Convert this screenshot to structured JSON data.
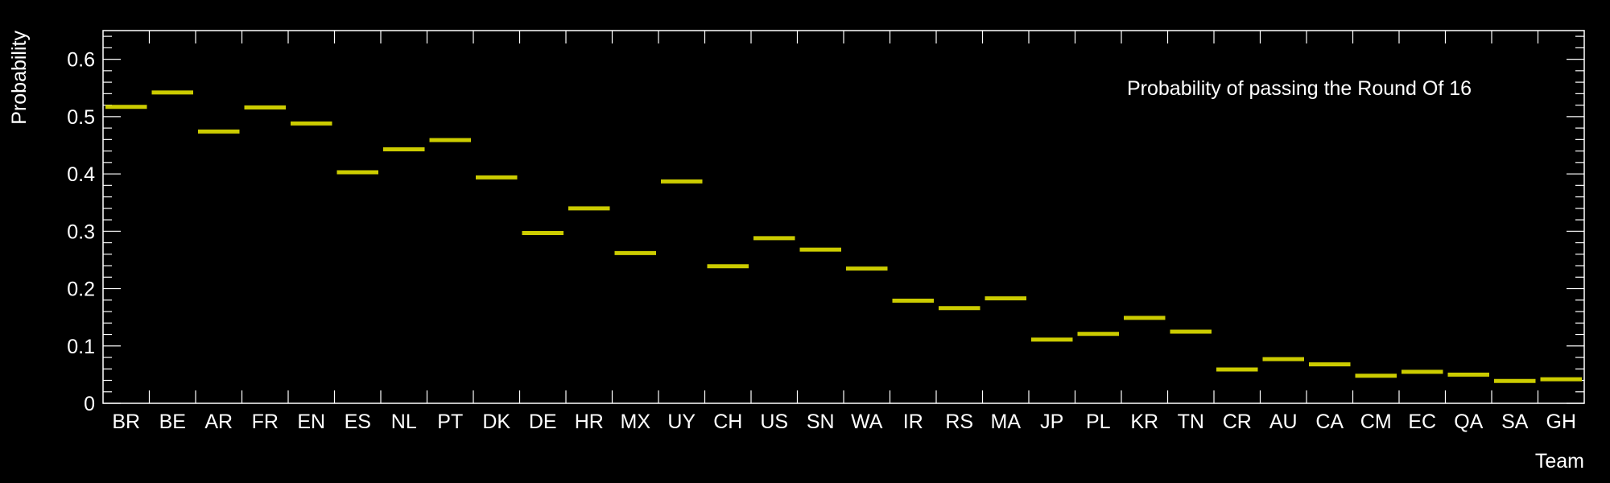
{
  "chart_data": {
    "type": "step",
    "title": "Probability of passing the Round Of 16",
    "xlabel": "Team",
    "ylabel": "Probability",
    "ylim": [
      0,
      0.65
    ],
    "yticks": [
      0,
      0.1,
      0.2,
      0.3,
      0.4,
      0.5,
      0.6
    ],
    "ytick_labels": [
      "0",
      "0.1",
      "0.2",
      "0.3",
      "0.4",
      "0.5",
      "0.6"
    ],
    "grid": false,
    "legend": "none",
    "categories": [
      "BR",
      "BE",
      "AR",
      "FR",
      "EN",
      "ES",
      "NL",
      "PT",
      "DK",
      "DE",
      "HR",
      "MX",
      "UY",
      "CH",
      "US",
      "SN",
      "WA",
      "IR",
      "RS",
      "MA",
      "JP",
      "PL",
      "KR",
      "TN",
      "CR",
      "AU",
      "CA",
      "CM",
      "EC",
      "QA",
      "SA",
      "GH"
    ],
    "values": [
      0.517,
      0.542,
      0.474,
      0.516,
      0.488,
      0.403,
      0.443,
      0.459,
      0.394,
      0.297,
      0.34,
      0.262,
      0.387,
      0.239,
      0.288,
      0.268,
      0.235,
      0.179,
      0.166,
      0.183,
      0.111,
      0.121,
      0.149,
      0.125,
      0.059,
      0.077,
      0.068,
      0.048,
      0.055,
      0.05,
      0.039,
      0.042
    ],
    "colors": {
      "background": "#000000",
      "axes": "#ffffff",
      "marker": "#cccc00"
    }
  }
}
